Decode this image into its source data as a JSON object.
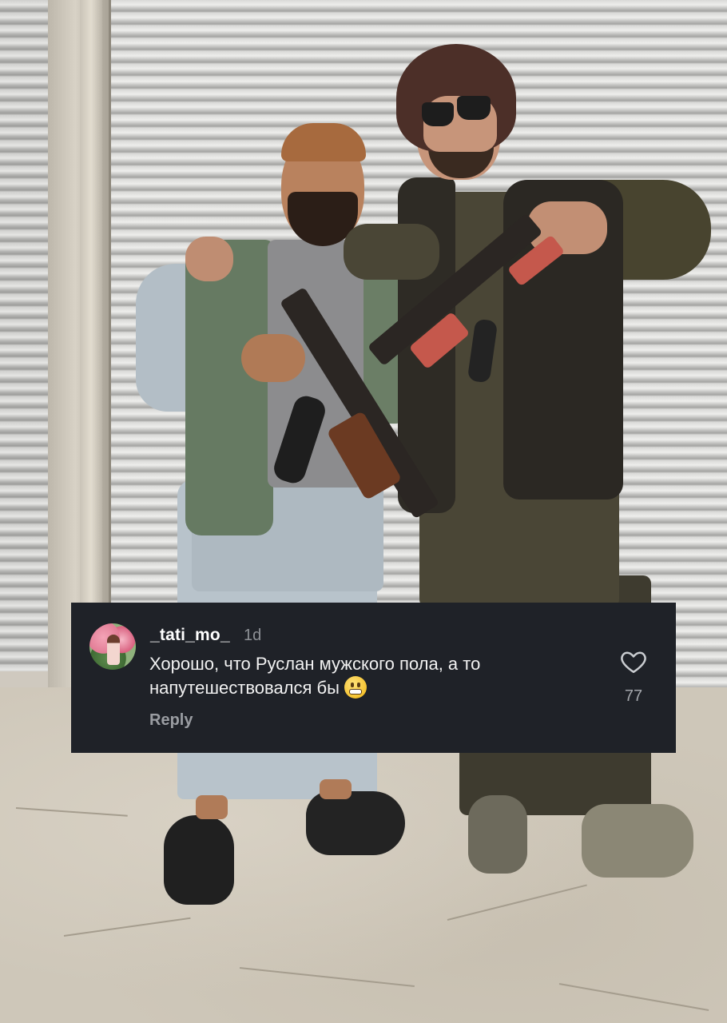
{
  "photo": {
    "scene": "two-men-with-rifles-in-front-of-shutter"
  },
  "comment": {
    "username": "_tati_mo_",
    "time_ago": "1d",
    "text_line1": "Хорошо, что Руслан мужского пола, а то",
    "text_line2": "напутешествовался бы",
    "emoji_icon": "grimacing-face-icon",
    "reply_label": "Reply",
    "like_icon": "heart-outline-icon",
    "like_count": "77"
  },
  "colors": {
    "card_background": "#1f2228",
    "username": "#ffffff",
    "secondary_text": "#8e9196"
  }
}
